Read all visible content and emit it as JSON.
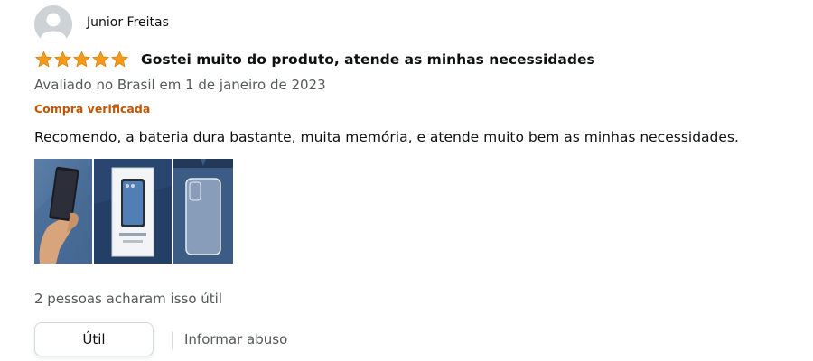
{
  "review": {
    "author": "Junior Freitas",
    "avatar_icon": "user-silhouette-icon",
    "rating": 5,
    "star_color": "#f79a1c",
    "title": "Gostei muito do produto, atende as minhas necessidades",
    "meta": "Avaliado no Brasil em 1 de janeiro de 2023",
    "verified_label": "Compra verificada",
    "verified_color": "#c45500",
    "body": "Recomendo, a bateria dura bastante, muita memória, e atende muito bem as minhas necessidades."
  },
  "images": [
    {
      "name": "review-photo-hand-holding-phone"
    },
    {
      "name": "review-photo-phone-box"
    },
    {
      "name": "review-photo-clear-case"
    }
  ],
  "footer": {
    "helpful_text": "2 pessoas acharam isso útil",
    "helpful_button": "Útil",
    "report_link": "Informar abuso"
  }
}
